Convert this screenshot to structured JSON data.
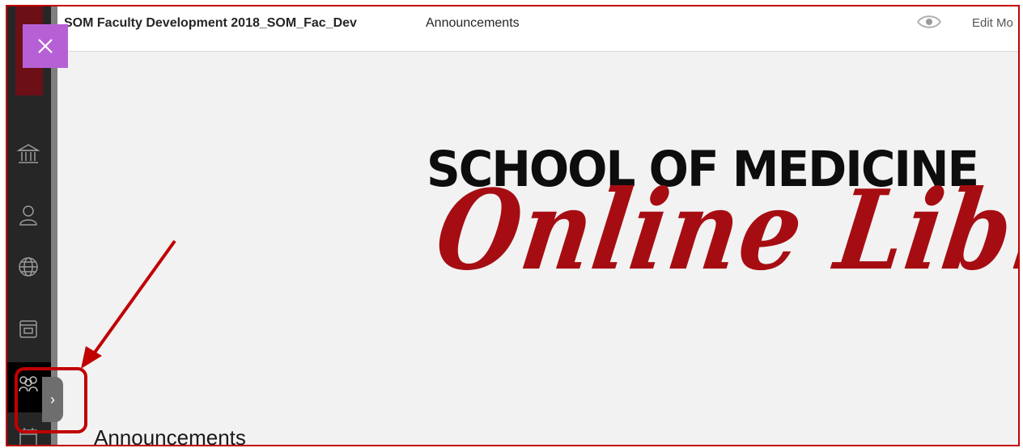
{
  "header": {
    "course_title": "SOM Faculty Development 2018_SOM_Fac_Dev",
    "page_label": "Announcements",
    "edit_mode_label": "Edit Mo",
    "eye_icon": "eye-preview-icon"
  },
  "banner": {
    "line1": "SCHOOL OF MEDICINE",
    "line2": "Online Library"
  },
  "content": {
    "heading": "Announcements"
  },
  "rail": {
    "icons": [
      "institution-icon",
      "person-icon",
      "globe-icon",
      "course-box-icon",
      "groups-icon",
      "calendar-icon"
    ]
  },
  "colors": {
    "rail_bg": "#262626",
    "close_tab": "#b760d6",
    "banner_red": "#a60d12",
    "annotation_red": "#c00000"
  }
}
